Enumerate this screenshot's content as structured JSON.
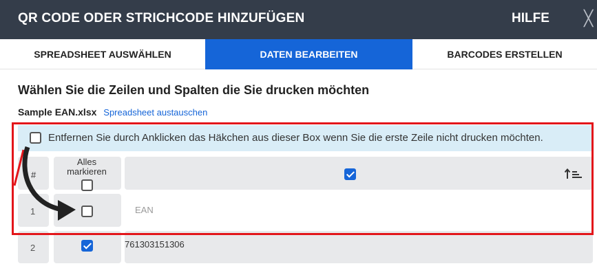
{
  "header": {
    "title": "QR CODE ODER STRICHCODE HINZUFÜGEN",
    "help_label": "HILFE",
    "close_glyph": "╳"
  },
  "tabs": [
    {
      "label": "SPREADSHEET AUSWÄHLEN",
      "active": false
    },
    {
      "label": "DATEN BEARBEITEN",
      "active": true
    },
    {
      "label": "BARCODES ERSTELLEN",
      "active": false
    }
  ],
  "main": {
    "heading": "Wählen Sie die Zeilen und Spalten die Sie drucken möchten",
    "file_name": "Sample EAN.xlsx",
    "replace_link": "Spreadsheet austauschen",
    "first_row_notice": "Entfernen Sie durch Anklicken das Häkchen aus dieser Box wenn Sie die erste Zeile nicht drucken möchten.",
    "first_row_checked": false
  },
  "table": {
    "header": {
      "hash": "#",
      "select_all_line1": "Alles",
      "select_all_line2": "markieren",
      "select_all_checked": false,
      "column_checked": true,
      "sort_icon": "sort-ascending-icon"
    },
    "rows": [
      {
        "number": "1",
        "checked": false,
        "value": "EAN"
      },
      {
        "number": "2",
        "checked": true,
        "value": "761303151306"
      }
    ]
  },
  "colors": {
    "header_bg": "#343d4a",
    "accent": "#1565d8",
    "info_bg": "#d9edf7",
    "annotation_red": "#e3151a"
  }
}
